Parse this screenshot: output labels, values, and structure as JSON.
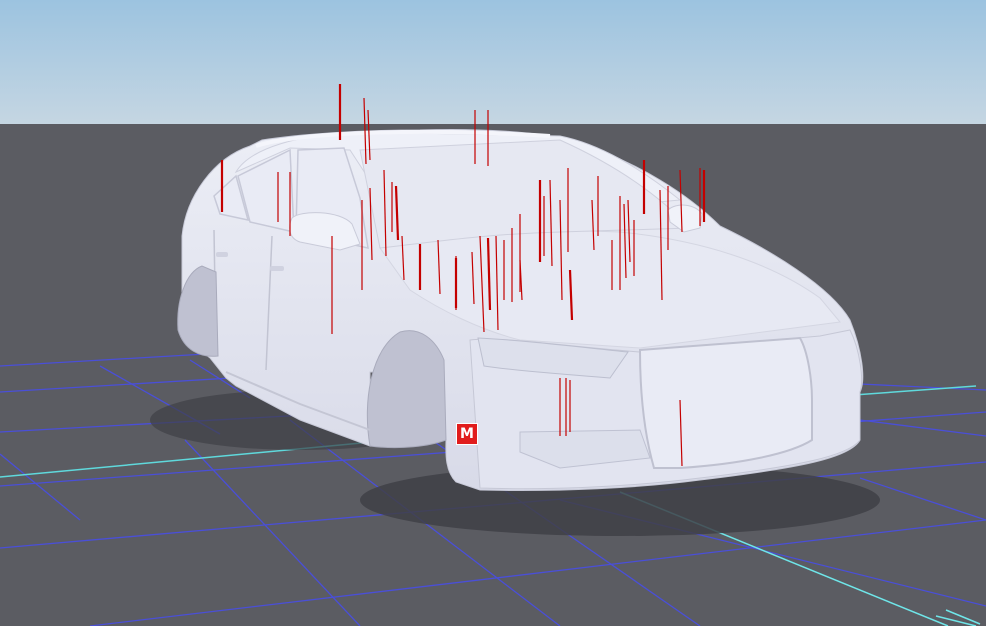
{
  "viewport": {
    "sky_top_color": "#9cc3e0",
    "sky_bottom_color": "#c5d6e2",
    "ground_color": "#5b5c62",
    "grid_color": "#4a4fd8",
    "axis_x_color": "#5fd9dc",
    "axis_y_color": "#6fe6e9",
    "model_color": "#e4e6f1",
    "model_shadow_color": "#a9abc0",
    "vertex_marker_color": "#c40000"
  },
  "model": {
    "name": "car-body",
    "icon": "car-mesh-icon"
  },
  "marker": {
    "label": "M",
    "color": "#e11d1d",
    "icon": "marker-badge-icon"
  }
}
